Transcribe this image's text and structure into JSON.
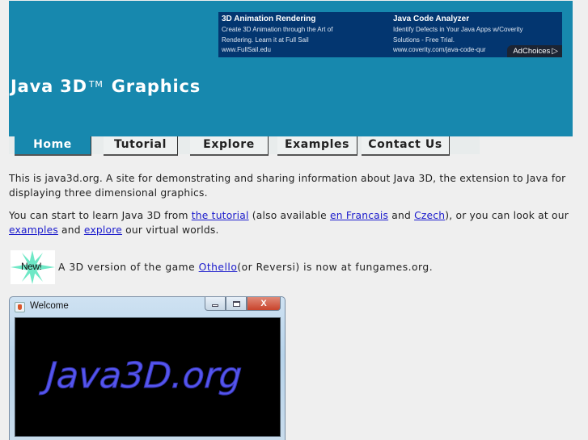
{
  "header": {
    "title": "Java 3D",
    "trademark": "TM",
    "title_suffix": "Graphics",
    "background_color": "#1788ae"
  },
  "ads": [
    {
      "title": "3D Animation Rendering",
      "lines": [
        "Create 3D Animation through the Art of",
        "Rendering. Learn it at Full Sail"
      ],
      "url": "www.FullSail.edu"
    },
    {
      "title": "Java Code Analyzer",
      "lines": [
        "Identify Defects in Your Java Apps w/Coverity",
        "Solutions - Free Trial."
      ],
      "url": "www.coverity.com/java-code-qur"
    }
  ],
  "adchoices_label": "AdChoices",
  "nav": {
    "tabs": [
      {
        "label": "Home",
        "active": true
      },
      {
        "label": "Tutorial",
        "active": false
      },
      {
        "label": "Explore",
        "active": false
      },
      {
        "label": "Examples",
        "active": false
      },
      {
        "label": "Contact Us",
        "active": false
      }
    ]
  },
  "content": {
    "intro": "This is java3d.org. A site for demonstrating and sharing information about Java 3D, the extension to Java for displaying three dimensional graphics.",
    "learn": {
      "t1": "You can start to learn Java 3D from ",
      "link_tutorial": "the tutorial",
      "t2": " (also available ",
      "link_french": "en Francais",
      "t3": " and ",
      "link_czech": "Czech",
      "t4": "), or you can look at our ",
      "link_examples": "examples",
      "t5": " and ",
      "link_explore": "explore",
      "t6": " our virtual worlds."
    },
    "news": {
      "badge": "New!",
      "t1": "A 3D version of the game ",
      "link_othello": "Othello",
      "t2": " (or Reversi) is now at fungames.org."
    }
  },
  "window": {
    "title": "Welcome",
    "close_glyph": "X",
    "canvas_text": "Java3D.org",
    "canvas_text_color": "#5555ee"
  }
}
